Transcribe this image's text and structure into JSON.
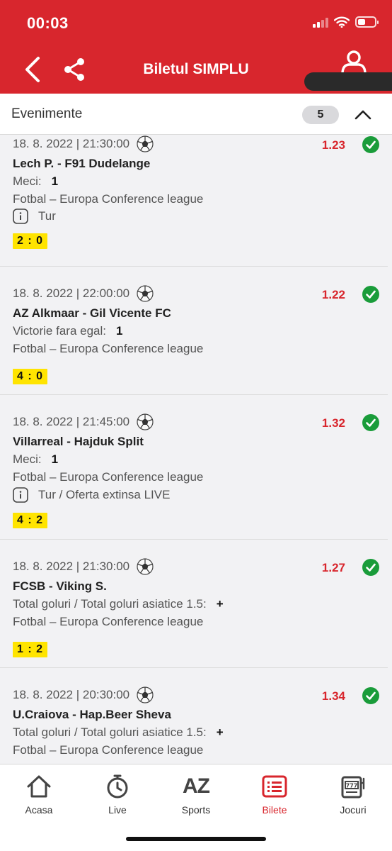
{
  "status_bar": {
    "time": "00:03",
    "battery_level": 0.45
  },
  "header": {
    "title": "Biletul SIMPLU",
    "back_icon": "chevron-left-icon",
    "share_icon": "share-icon",
    "user_icon": "user-icon",
    "accent": "#d8262d"
  },
  "section": {
    "label": "Evenimente",
    "count": "5"
  },
  "events": [
    {
      "datetime": "18. 8. 2022 | 21:30:00",
      "teams": "Lech P. - F91 Dudelange",
      "market": "Meci:",
      "pick": "1",
      "sport_league": "Fotbal – Europa Conference league",
      "info": "Tur",
      "score": "2 : 0",
      "odds": "1.23"
    },
    {
      "datetime": "18. 8. 2022 | 22:00:00",
      "teams": "AZ Alkmaar - Gil Vicente FC",
      "market": "Victorie fara egal:",
      "pick": "1",
      "sport_league": "Fotbal – Europa Conference league",
      "info": "",
      "score": "4 : 0",
      "odds": "1.22"
    },
    {
      "datetime": "18. 8. 2022 | 21:45:00",
      "teams": "Villarreal - Hajduk Split",
      "market": "Meci:",
      "pick": "1",
      "sport_league": "Fotbal – Europa Conference league",
      "info": "Tur / Oferta extinsa LIVE",
      "score": "4 : 2",
      "odds": "1.32"
    },
    {
      "datetime": "18. 8. 2022 | 21:30:00",
      "teams": "FCSB - Viking S.",
      "market": "Total goluri / Total goluri asiatice 1.5:",
      "pick": "+",
      "sport_league": "Fotbal – Europa Conference league",
      "info": "",
      "score": "1 : 2",
      "odds": "1.27"
    },
    {
      "datetime": "18. 8. 2022 | 20:30:00",
      "teams": "U.Craiova - Hap.Beer Sheva",
      "market": "Total goluri / Total goluri asiatice 1.5:",
      "pick": "+",
      "sport_league": "Fotbal – Europa Conference league",
      "info": "",
      "score": "",
      "odds": "1.34"
    }
  ],
  "bottom_nav": [
    {
      "label": "Acasa",
      "icon": "home-icon",
      "active": false
    },
    {
      "label": "Live",
      "icon": "stopwatch-icon",
      "active": false
    },
    {
      "label": "Sports",
      "icon": "az-icon",
      "active": false
    },
    {
      "label": "Bilete",
      "icon": "ticket-list-icon",
      "active": true
    },
    {
      "label": "Jocuri",
      "icon": "slot-machine-icon",
      "active": false
    }
  ]
}
